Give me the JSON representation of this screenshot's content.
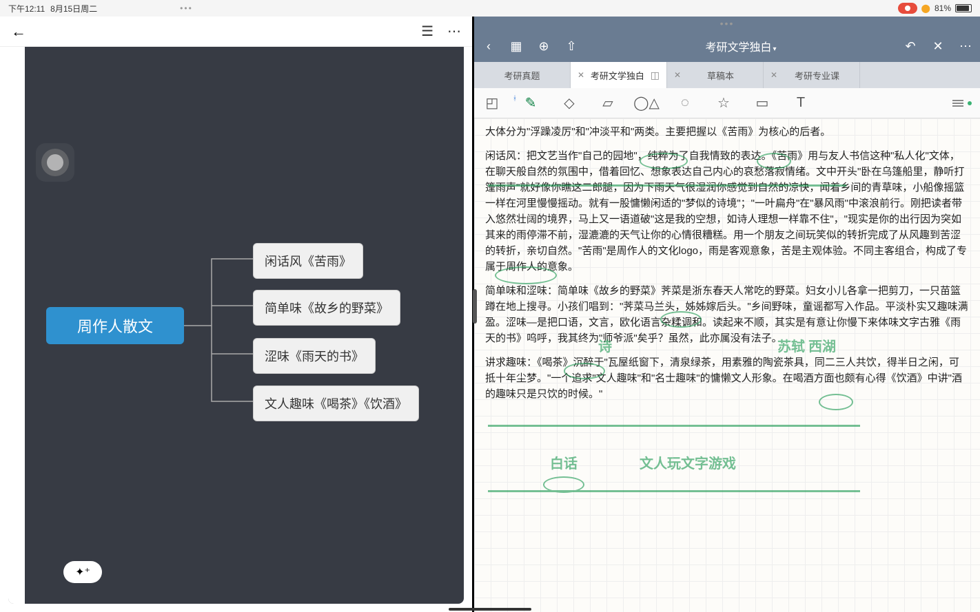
{
  "status_bar": {
    "time": "下午12:11",
    "date": "8月15日周二",
    "battery_percent": "81%"
  },
  "left_app": {
    "mindmap": {
      "root": "周作人散文",
      "children": [
        "闲话风《苦雨》",
        "简单味《故乡的野菜》",
        "涩味《雨天的书》",
        "文人趣味《喝茶》《饮酒》"
      ]
    }
  },
  "right_app": {
    "title": "考研文学独白",
    "tabs": [
      {
        "label": "考研真题",
        "active": false
      },
      {
        "label": "考研文学独白",
        "active": true
      },
      {
        "label": "草稿本",
        "active": false
      },
      {
        "label": "考研专业课",
        "active": false
      }
    ],
    "note_paragraphs": [
      "大体分为\"浮躁凌厉\"和\"冲淡平和\"两类。主要把握以《苦雨》为核心的后者。",
      "闲话风：把文艺当作\"自己的园地\"，纯粹为了自我情致的表达。《苦雨》用与友人书信这种\"私人化\"文体，在聊天般自然的氛围中，借着回忆、想象表达自己内心的哀愁落寂情绪。文中开头\"卧在乌篷船里，静听打篷雨声\"就好像你瞧这二郎腿，因为下雨天气很湿润你感觉到自然的凉快，闻着乡间的青草味，小船像摇篮一样在河里慢慢摇动。就有一股慵懒闲适的\"梦似的诗境\"；\"一叶扁舟\"在\"暴风雨\"中滚浪前行。刚把读者带入悠然壮阔的境界，马上又一语道破\"这是我的空想，如诗人理想一样靠不住\"，\"现实是你的出行因为突如其来的雨停滞不前，湿漉漉的天气让你的心情很糟糕。用一个朋友之间玩笑似的转折完成了从风趣到苦涩的转折，亲切自然。\"苦雨\"是周作人的文化logo，雨是客观意象，苦是主观体验。不同主客组合，构成了专属于周作人的意象。",
      "简单味和涩味：简单味《故乡的野菜》荠菜是浙东春天人常吃的野菜。妇女小儿各拿一把剪刀，一只苗篮蹲在地上搜寻。小孩们唱到：\"荠菜马兰头，姊姊嫁后头。\"乡间野味，童谣都写入作品。平淡朴实又趣味满盈。涩味—是把口语，文言，欧化语言杂糅调和。读起来不顺，其实是有意让你慢下来体味文字古雅《雨天的书》呜呼，我其终为\"师爷派\"矣乎？虽然，此亦属没有法子。",
      "讲求趣味：《喝茶》沉醉于\"瓦屋纸窗下，清泉绿茶，用素雅的陶瓷茶具，同二三人共饮，得半日之闲，可抵十年尘梦。\"一个追求\"文人趣味\"和\"名士趣味\"的慵懒文人形象。在喝酒方面也颇有心得《饮酒》中讲\"酒的趣味只是只饮的时候。\""
    ],
    "handwritten_annotations": [
      "诗",
      "苏轼 西湖",
      "白话",
      "文人玩文字游戏"
    ]
  }
}
